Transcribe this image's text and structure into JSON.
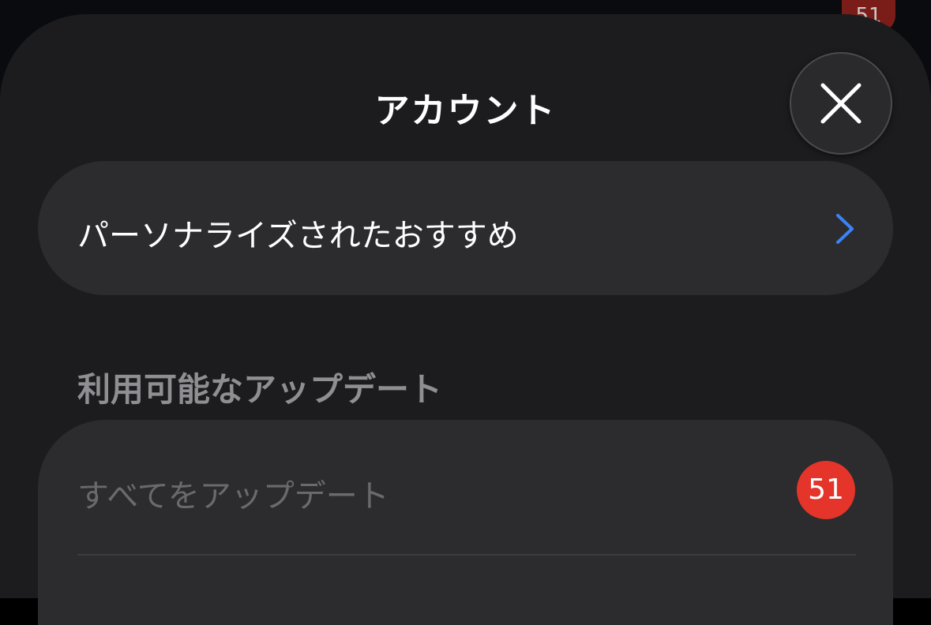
{
  "backdrop": {
    "badge_count": "51"
  },
  "sheet": {
    "title": "アカウント",
    "close_icon": "close-x-icon"
  },
  "recommend_row": {
    "label": "パーソナライズされたおすすめ",
    "chevron_icon": "chevron-right-icon",
    "chevron_color": "#3a82f7"
  },
  "updates_section": {
    "header": "利用可能なアップデート",
    "update_all_label": "すべてをアップデート",
    "badge_count": "51",
    "badge_color": "#e5342a"
  }
}
